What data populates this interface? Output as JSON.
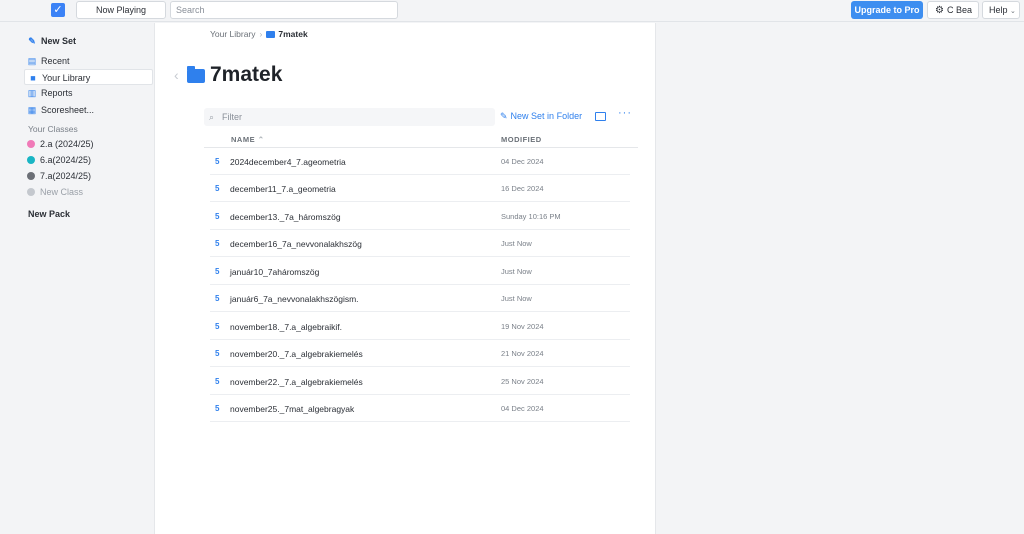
{
  "topbar": {
    "now_playing": "Now Playing",
    "search_placeholder": "Search",
    "upgrade": "Upgrade to Pro",
    "user": "C Bea",
    "help": "Help"
  },
  "sidebar": {
    "new_set": "New Set",
    "recent": "Recent",
    "your_library": "Your Library",
    "reports": "Reports",
    "scoresheet": "Scoresheet...",
    "classes_header": "Your Classes",
    "classes": [
      {
        "label": "2.a (2024/25)",
        "color": "#f07ab8"
      },
      {
        "label": "6.a(2024/25)",
        "color": "#19b5c4"
      },
      {
        "label": "7.a(2024/25)",
        "color": "#6b6f76"
      }
    ],
    "new_class": "New Class",
    "new_pack": "New Pack"
  },
  "main": {
    "breadcrumb_root": "Your Library",
    "breadcrumb_current": "7matek",
    "title": "7matek",
    "filter_placeholder": "Filter",
    "new_set_in_folder": "New Set in Folder",
    "col_name": "NAME",
    "col_modified": "MODIFIED",
    "rows": [
      {
        "badge": "5",
        "name": "2024december4_7.ageometria",
        "modified": "04 Dec 2024"
      },
      {
        "badge": "5",
        "name": "december11_7.a_geometria",
        "modified": "16 Dec 2024"
      },
      {
        "badge": "5",
        "name": "december13._7a_háromszög",
        "modified": "Sunday 10:16 PM"
      },
      {
        "badge": "5",
        "name": "december16_7a_nevvonalakhszög",
        "modified": "Just Now"
      },
      {
        "badge": "5",
        "name": "január10_7aháromszög",
        "modified": "Just Now"
      },
      {
        "badge": "5",
        "name": "január6_7a_nevvonalakhszögism.",
        "modified": "Just Now"
      },
      {
        "badge": "5",
        "name": "november18._7.a_algebraikif.",
        "modified": "19 Nov 2024"
      },
      {
        "badge": "5",
        "name": "november20._7.a_algebrakiemelés",
        "modified": "21 Nov 2024"
      },
      {
        "badge": "5",
        "name": "november22._7.a_algebrakiemelés",
        "modified": "25 Nov 2024"
      },
      {
        "badge": "5",
        "name": "november25._7mat_algebragyak",
        "modified": "04 Dec 2024"
      }
    ]
  }
}
